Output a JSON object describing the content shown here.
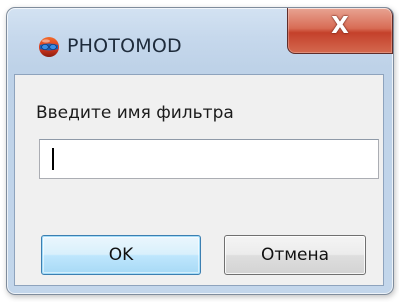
{
  "window": {
    "title": "PHOTOMOD",
    "app_icon": "photomod-logo-icon",
    "close_icon": "close-icon",
    "close_glyph": "X"
  },
  "dialog": {
    "prompt_label": "Введите имя фильтра",
    "filter_name_value": "",
    "ok_label": "OK",
    "cancel_label": "Отмена"
  },
  "colors": {
    "frame": "#c3d6eb",
    "close_button": "#c4412b",
    "client_background": "#f0f0f0",
    "default_button_border": "#3c7fb1"
  }
}
